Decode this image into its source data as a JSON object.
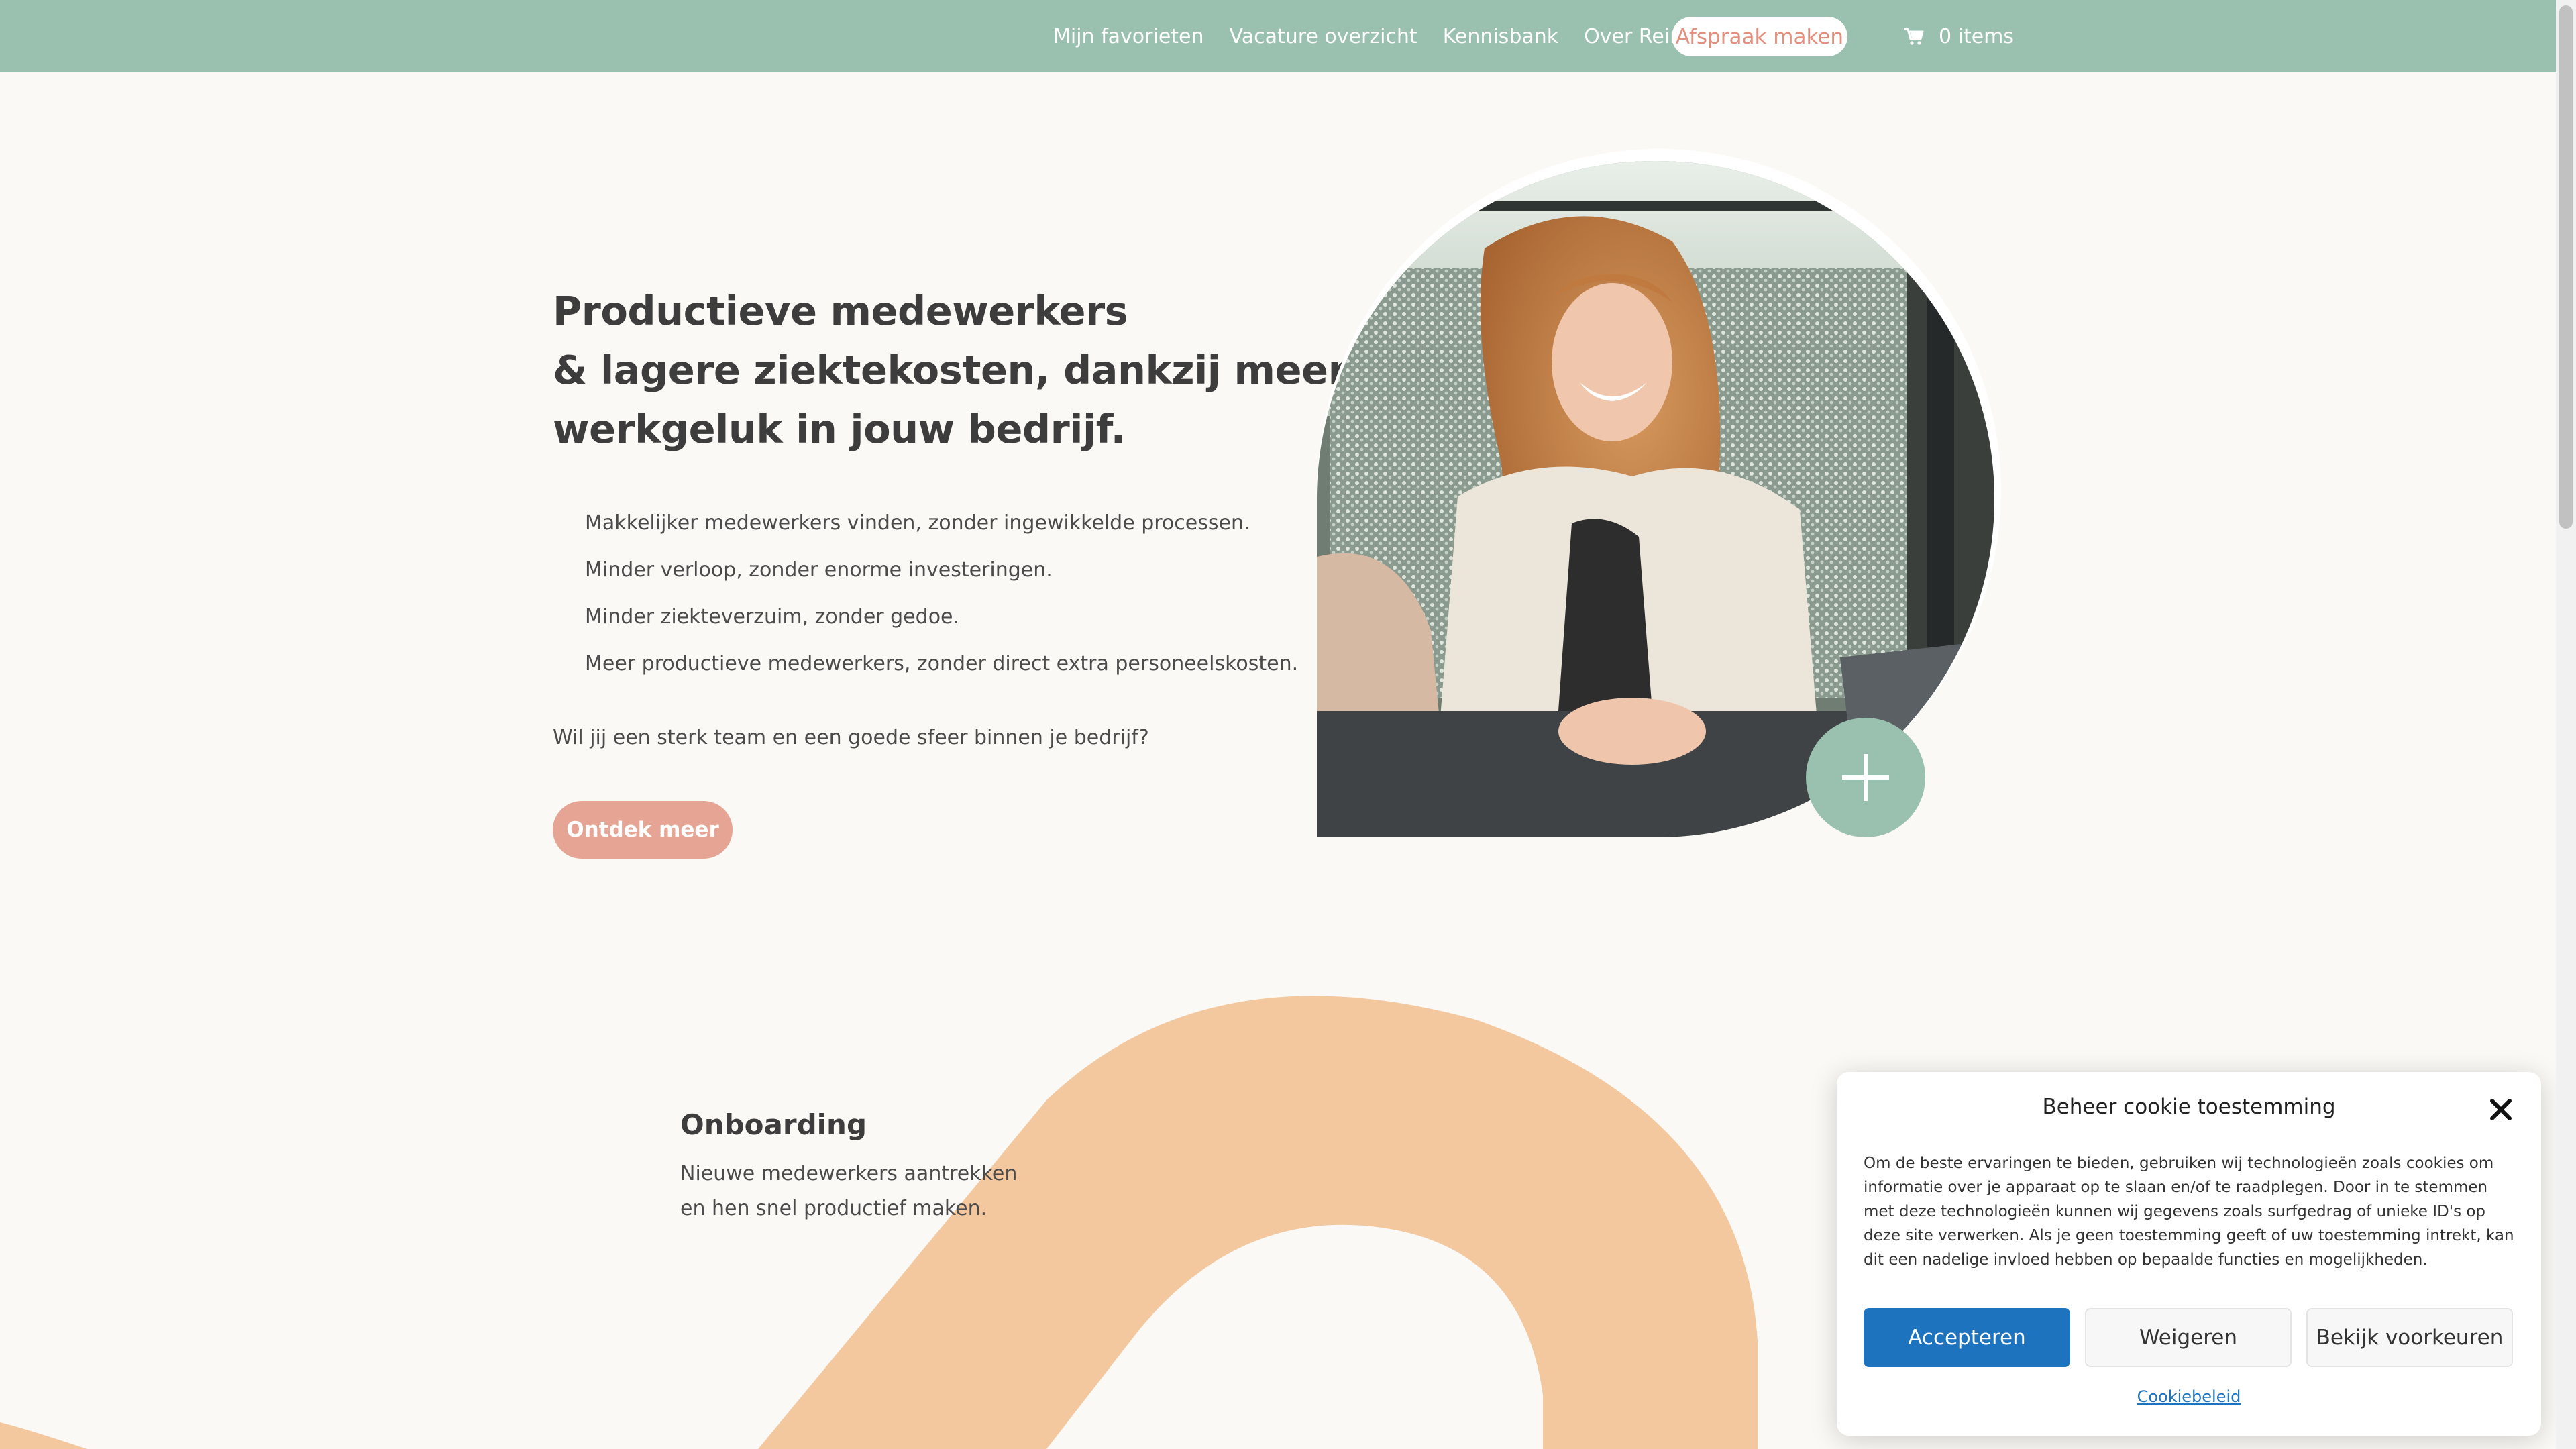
{
  "nav": {
    "links": [
      "Mijn favorieten",
      "Vacature overzicht",
      "Kennisbank",
      "Over Reinouw"
    ],
    "cta": "Afspraak maken",
    "cart_icon": "cart-icon",
    "cart_label": "0 items"
  },
  "hero": {
    "title_lines": [
      "Productieve medewerkers",
      "& lagere ziektekosten, dankzij meer",
      "werkgeluk in jouw bedrijf."
    ],
    "bullets": [
      "Makkelijker medewerkers vinden, zonder ingewikkelde processen.",
      "Minder verloop, zonder enorme investeringen.",
      "Minder ziekteverzuim, zonder gedoe.",
      "Meer productieve medewerkers, zonder direct extra personeelskosten."
    ],
    "question": "Wil jij een sterk team en een goede sfeer binnen je bedrijf?",
    "button": "Ontdek meer",
    "plus_icon": "plus-icon"
  },
  "section": {
    "title": "Onboarding",
    "text_lines": [
      "Nieuwe medewerkers aantrekken",
      "en hen snel productief maken."
    ]
  },
  "cookie": {
    "title": "Beheer cookie toestemming",
    "body": "Om de beste ervaringen te bieden, gebruiken wij technologieën zoals cookies om informatie over je apparaat op te slaan en/of te raadplegen. Door in te stemmen met deze technologieën kunnen wij gegevens zoals surfgedrag of unieke ID's op deze site verwerken. Als je geen toestemming geeft of uw toestemming intrekt, kan dit een nadelige invloed hebben op bepaalde functies en mogelijkheden.",
    "accept": "Accepteren",
    "deny": "Weigeren",
    "prefs": "Bekijk voorkeuren",
    "policy_link": "Cookiebeleid"
  },
  "colors": {
    "nav_bg": "#9ac0b0",
    "accent_salmon": "#e6a594",
    "arc_peach": "#f4c89f",
    "accept_blue": "#1e73be"
  }
}
